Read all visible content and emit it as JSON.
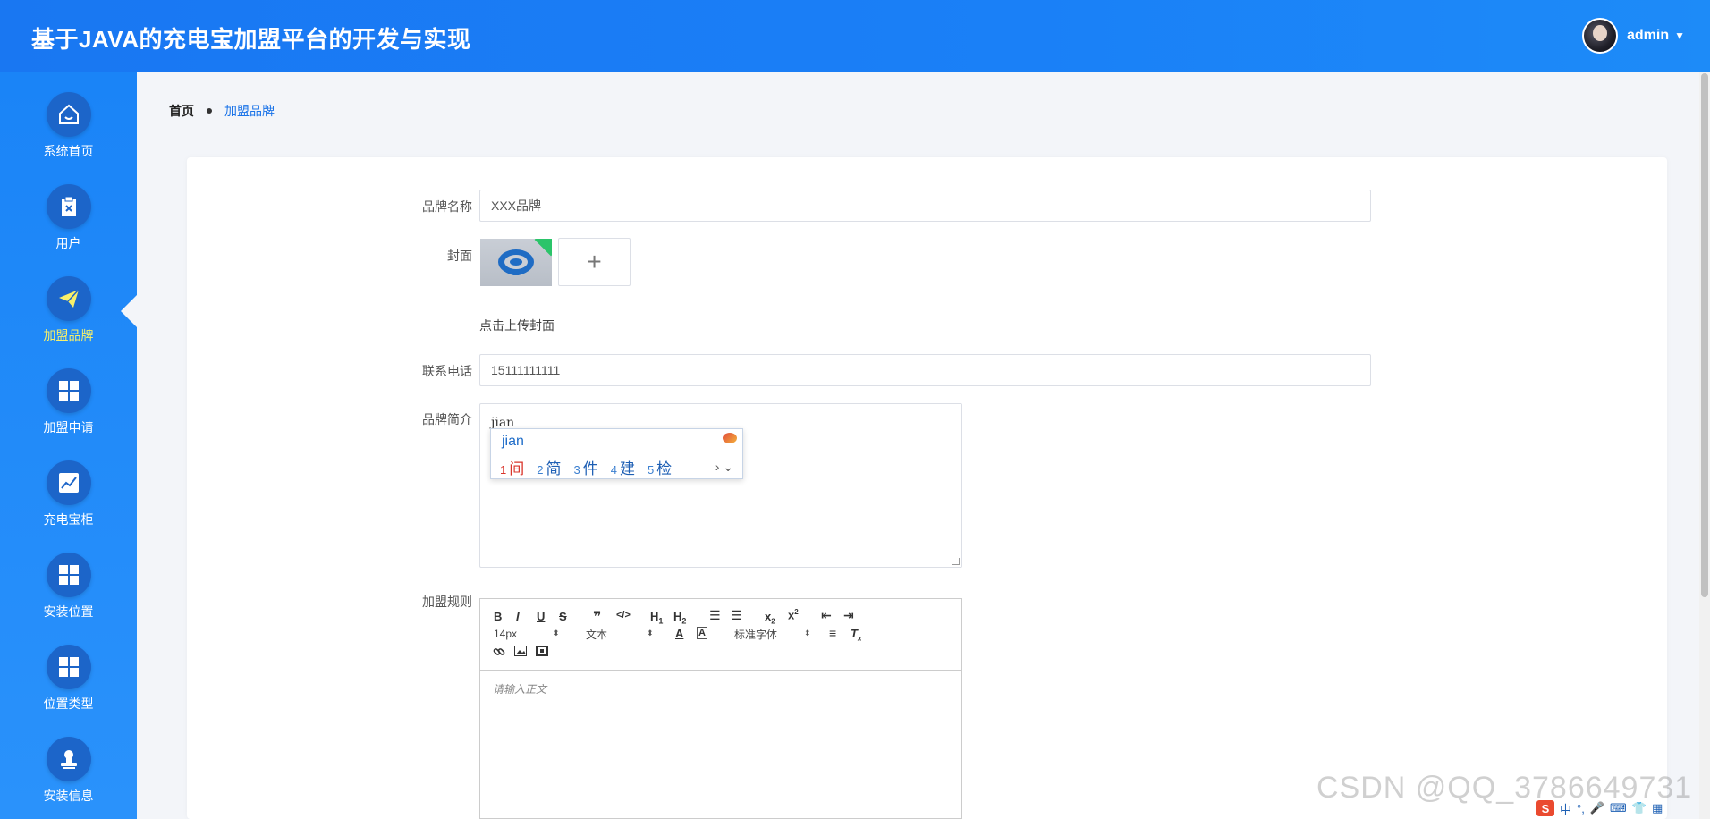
{
  "header": {
    "title": "基于JAVA的充电宝加盟平台的开发与实现",
    "username": "admin"
  },
  "sidebar": {
    "items": [
      {
        "label": "系统首页",
        "icon": "home-icon"
      },
      {
        "label": "用户",
        "icon": "clipboard-icon"
      },
      {
        "label": "加盟品牌",
        "icon": "paper-plane-icon",
        "active": true
      },
      {
        "label": "加盟申请",
        "icon": "grid-icon"
      },
      {
        "label": "充电宝柜",
        "icon": "chart-icon"
      },
      {
        "label": "安装位置",
        "icon": "grid-icon"
      },
      {
        "label": "位置类型",
        "icon": "grid-icon"
      },
      {
        "label": "安装信息",
        "icon": "stamp-icon"
      }
    ]
  },
  "breadcrumb": {
    "home": "首页",
    "current": "加盟品牌"
  },
  "form": {
    "brand_name_label": "品牌名称",
    "brand_name_value": "XXX品牌",
    "cover_label": "封面",
    "cover_upload_hint": "点击上传封面",
    "upload_plus": "+",
    "phone_label": "联系电话",
    "phone_value": "15111111111",
    "intro_label": "品牌简介",
    "intro_value": "jian",
    "rules_label": "加盟规则",
    "rules_placeholder": "请输入正文"
  },
  "ime": {
    "pinyin": "jian",
    "candidates": [
      {
        "n": "1",
        "c": "间"
      },
      {
        "n": "2",
        "c": "简"
      },
      {
        "n": "3",
        "c": "件"
      },
      {
        "n": "4",
        "c": "建"
      },
      {
        "n": "5",
        "c": "检"
      }
    ],
    "nav": "› ⌄"
  },
  "editor": {
    "font_size": "14px",
    "paragraph": "文本",
    "font_family": "标准字体"
  },
  "watermark": "CSDN @QQ_3786649731",
  "tray": {
    "lang": "中"
  },
  "colors": {
    "header_bg": "#1977f2",
    "sidebar_bg": "#1a84f7",
    "active_label": "#f8f06a",
    "link": "#1a73e8"
  }
}
